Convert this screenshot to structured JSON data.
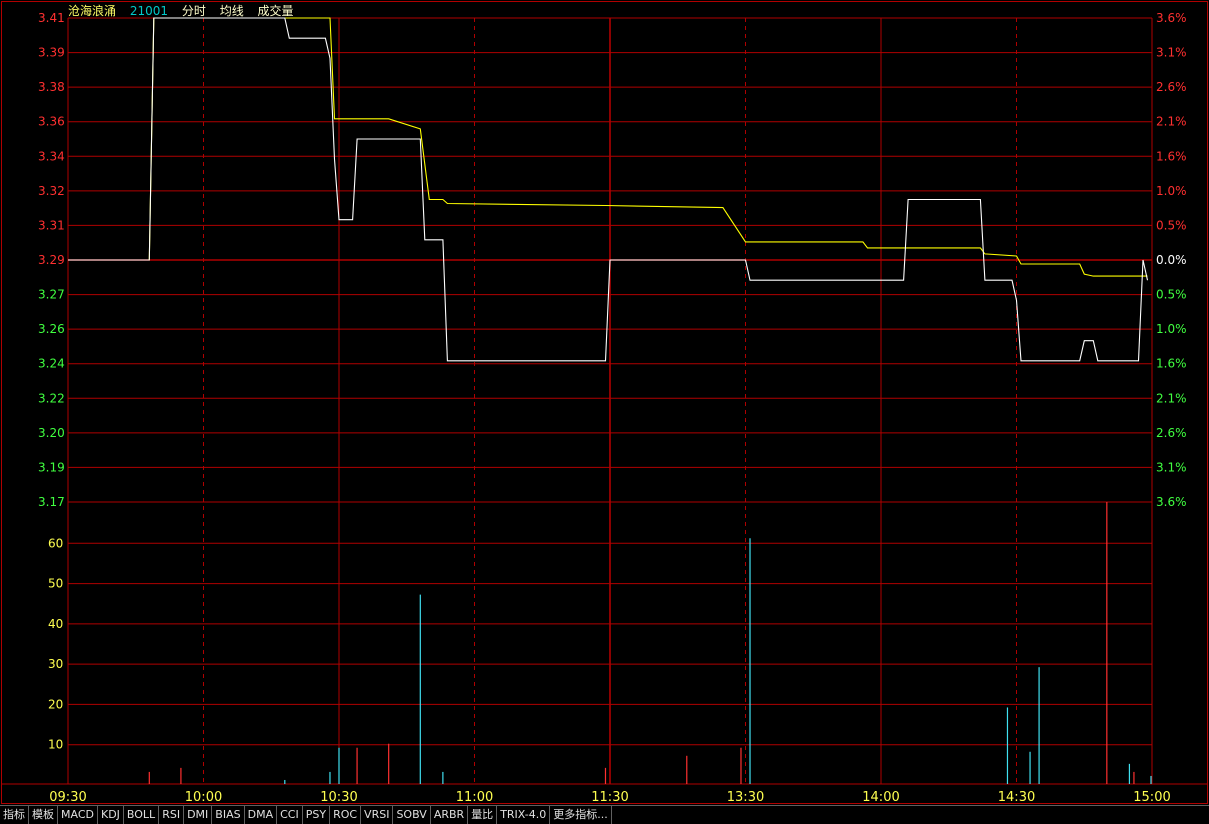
{
  "header": {
    "name": "沧海浪涌",
    "code": "21001",
    "label_minute": "分时",
    "label_avg": "均线",
    "label_volume": "成交量"
  },
  "colors": {
    "grid": "#b00000",
    "axis_red": "#ff3030",
    "axis_green": "#40ff40",
    "axis_yellow": "#ffff50",
    "price_line": "#ffffff",
    "avg_line": "#ffff00",
    "vol_up": "#ff3030",
    "vol_down": "#40e0f0"
  },
  "tabs": [
    "指标",
    "模板",
    "MACD",
    "KDJ",
    "BOLL",
    "RSI",
    "DMI",
    "BIAS",
    "DMA",
    "CCI",
    "PSY",
    "ROC",
    "VRSI",
    "SOBV",
    "ARBR",
    "量比",
    "TRIX-4.0",
    "更多指标..."
  ],
  "chart_data": {
    "type": "line",
    "prev_close": 3.29,
    "price_ticks": [
      "3.41",
      "3.39",
      "3.38",
      "3.36",
      "3.34",
      "3.32",
      "3.31",
      "3.29",
      "3.27",
      "3.26",
      "3.24",
      "3.22",
      "3.20",
      "3.19",
      "3.17"
    ],
    "pct_ticks": [
      "3.6%",
      "3.1%",
      "2.6%",
      "2.1%",
      "1.6%",
      "1.0%",
      "0.5%",
      "0.0%",
      "0.5%",
      "1.0%",
      "1.6%",
      "2.1%",
      "2.6%",
      "3.1%",
      "3.6%"
    ],
    "ylim_price": [
      3.17,
      3.41
    ],
    "time_ticks": [
      "09:30",
      "10:00",
      "10:30",
      "11:00",
      "11:30",
      "13:30",
      "14:00",
      "14:30",
      "15:00"
    ],
    "volume_ticks": [
      "60",
      "50",
      "40",
      "30",
      "20",
      "10"
    ],
    "ylim_volume": [
      0,
      70
    ],
    "xlim_minutes": [
      0,
      240
    ],
    "price_series": {
      "name": "分时",
      "points": [
        [
          0,
          3.29
        ],
        [
          18,
          3.29
        ],
        [
          19,
          3.41
        ],
        [
          48,
          3.41
        ],
        [
          49,
          3.4
        ],
        [
          57,
          3.4
        ],
        [
          58,
          3.39
        ],
        [
          59,
          3.34
        ],
        [
          60,
          3.31
        ],
        [
          63,
          3.31
        ],
        [
          64,
          3.35
        ],
        [
          78,
          3.35
        ],
        [
          79,
          3.3
        ],
        [
          83,
          3.3
        ],
        [
          84,
          3.24
        ],
        [
          119,
          3.24
        ],
        [
          120,
          3.29
        ],
        [
          150,
          3.29
        ],
        [
          151,
          3.28
        ],
        [
          185,
          3.28
        ],
        [
          186,
          3.32
        ],
        [
          202,
          3.32
        ],
        [
          203,
          3.28
        ],
        [
          209,
          3.28
        ],
        [
          210,
          3.27
        ],
        [
          211,
          3.24
        ],
        [
          224,
          3.24
        ],
        [
          225,
          3.25
        ],
        [
          227,
          3.25
        ],
        [
          228,
          3.24
        ],
        [
          237,
          3.24
        ],
        [
          238,
          3.29
        ],
        [
          239,
          3.28
        ]
      ]
    },
    "avg_series": {
      "name": "均线",
      "points": [
        [
          0,
          3.29
        ],
        [
          18,
          3.29
        ],
        [
          19,
          3.41
        ],
        [
          58,
          3.41
        ],
        [
          59,
          3.36
        ],
        [
          71,
          3.36
        ],
        [
          78,
          3.355
        ],
        [
          80,
          3.32
        ],
        [
          83,
          3.32
        ],
        [
          84,
          3.318
        ],
        [
          119,
          3.317
        ],
        [
          145,
          3.316
        ],
        [
          150,
          3.299
        ],
        [
          176,
          3.299
        ],
        [
          177,
          3.296
        ],
        [
          202,
          3.296
        ],
        [
          203,
          3.293
        ],
        [
          210,
          3.292
        ],
        [
          211,
          3.288
        ],
        [
          224,
          3.288
        ],
        [
          225,
          3.283
        ],
        [
          227,
          3.282
        ],
        [
          239,
          3.282
        ]
      ]
    },
    "volume": [
      {
        "t": 18,
        "v": 3,
        "dir": "up"
      },
      {
        "t": 25,
        "v": 4,
        "dir": "up"
      },
      {
        "t": 48,
        "v": 1,
        "dir": "down"
      },
      {
        "t": 58,
        "v": 3,
        "dir": "down"
      },
      {
        "t": 60,
        "v": 9,
        "dir": "down"
      },
      {
        "t": 64,
        "v": 9,
        "dir": "up"
      },
      {
        "t": 71,
        "v": 10,
        "dir": "up"
      },
      {
        "t": 78,
        "v": 47,
        "dir": "down"
      },
      {
        "t": 83,
        "v": 3,
        "dir": "down"
      },
      {
        "t": 119,
        "v": 4,
        "dir": "up"
      },
      {
        "t": 137,
        "v": 7,
        "dir": "up"
      },
      {
        "t": 149,
        "v": 9,
        "dir": "up"
      },
      {
        "t": 151,
        "v": 61,
        "dir": "down"
      },
      {
        "t": 208,
        "v": 19,
        "dir": "down"
      },
      {
        "t": 213,
        "v": 8,
        "dir": "down"
      },
      {
        "t": 215,
        "v": 29,
        "dir": "down"
      },
      {
        "t": 230,
        "v": 70,
        "dir": "up"
      },
      {
        "t": 235,
        "v": 5,
        "dir": "down"
      },
      {
        "t": 236,
        "v": 3,
        "dir": "up"
      },
      {
        "t": 241,
        "v": 2,
        "dir": "down"
      }
    ]
  }
}
